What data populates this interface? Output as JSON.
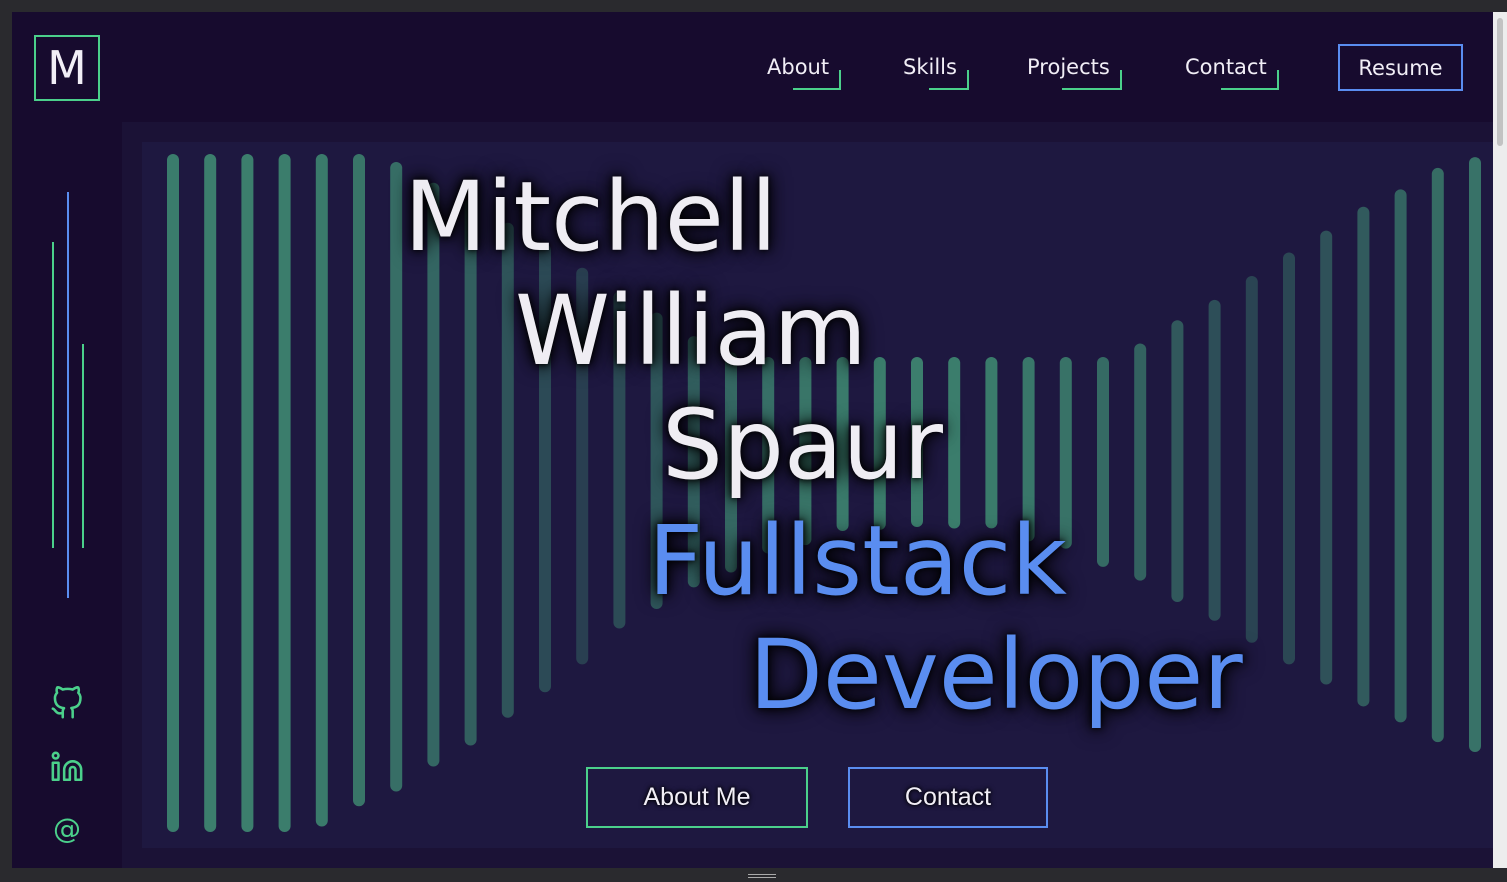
{
  "logo": {
    "letter": "M"
  },
  "nav": {
    "links": [
      {
        "label": "About"
      },
      {
        "label": "Skills"
      },
      {
        "label": "Projects"
      },
      {
        "label": "Contact"
      }
    ],
    "resume_label": "Resume"
  },
  "social": {
    "github_icon": "github-icon",
    "linkedin_icon": "linkedin-icon",
    "email_glyph": "@"
  },
  "hero": {
    "name_lines": [
      "Mitchell",
      "William",
      "Spaur"
    ],
    "role_lines": [
      "Fullstack",
      "Developer"
    ],
    "buttons": {
      "about": "About Me",
      "contact": "Contact"
    }
  },
  "colors": {
    "background": "#170b2e",
    "accent_green": "#4bd08b",
    "accent_blue": "#5a8df0",
    "text": "#efedf3"
  }
}
